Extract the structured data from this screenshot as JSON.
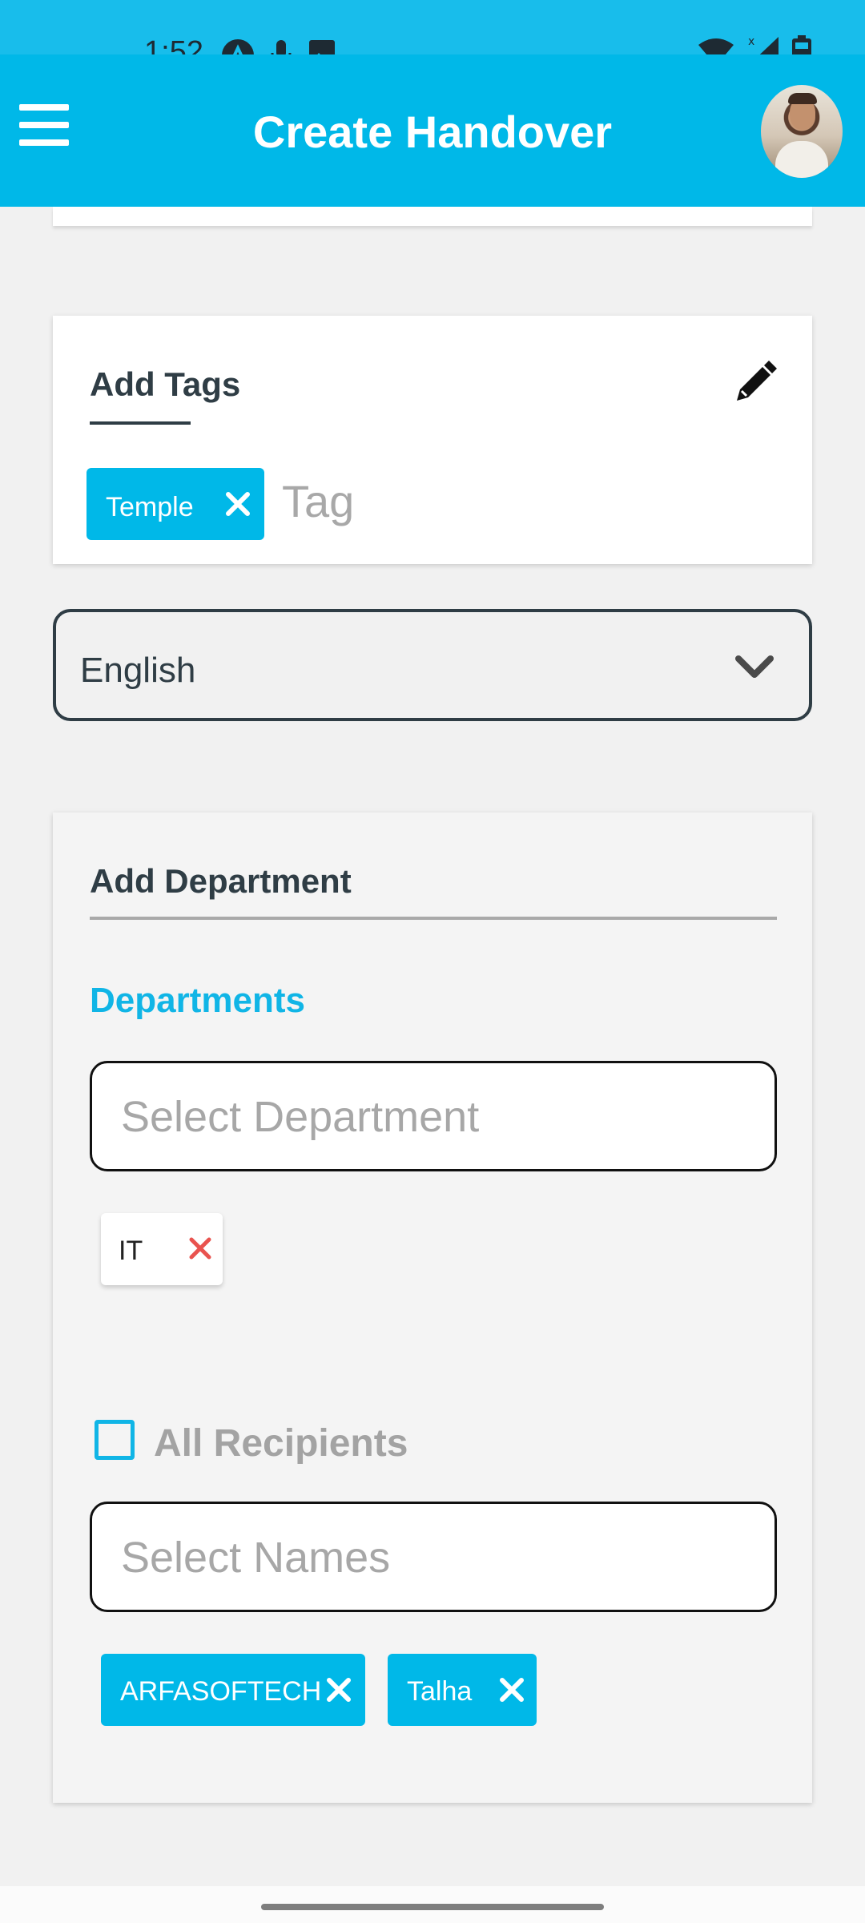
{
  "status_bar": {
    "time": "1:52",
    "icons_left": [
      "app-notification-icon",
      "microphone-icon",
      "image-icon"
    ],
    "icons_right": [
      "wifi-icon",
      "signal-icon",
      "battery-icon"
    ]
  },
  "app_bar": {
    "title": "Create Handover",
    "menu_icon": "hamburger-menu-icon",
    "avatar": "user-avatar"
  },
  "tags": {
    "title": "Add Tags",
    "edit_icon": "pencil-icon",
    "chips": [
      {
        "label": "Temple"
      }
    ],
    "input_placeholder": "Tag"
  },
  "language": {
    "selected": "English"
  },
  "department": {
    "title": "Add Department",
    "label": "Departments",
    "select_placeholder": "Select Department",
    "selected": [
      {
        "label": "IT"
      }
    ],
    "all_recipients_label": "All Recipients",
    "all_recipients_checked": false,
    "names_placeholder": "Select Names",
    "recipients": [
      {
        "label": "ARFASOFTECH"
      },
      {
        "label": "Talha"
      }
    ]
  },
  "colors": {
    "primary": "#00b8e8",
    "status_bar": "#18bdeb",
    "text_dark": "#2f3d45",
    "remove_red": "#e9534f",
    "background": "#f1f1f1"
  }
}
